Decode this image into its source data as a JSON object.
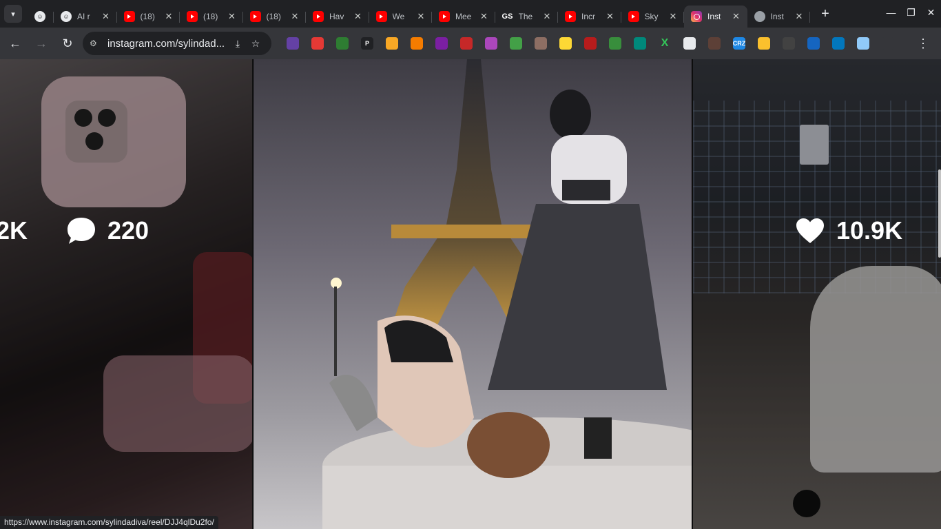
{
  "tabstrip": {
    "search_icon": "chevron-down-icon",
    "tabs": [
      {
        "title": "",
        "favicon": "ai-face"
      },
      {
        "title": "AI r",
        "favicon": "ai-face"
      },
      {
        "title": "(18)",
        "favicon": "youtube"
      },
      {
        "title": "(18)",
        "favicon": "youtube"
      },
      {
        "title": "(18)",
        "favicon": "youtube"
      },
      {
        "title": "Hav",
        "favicon": "youtube"
      },
      {
        "title": "We",
        "favicon": "youtube"
      },
      {
        "title": "Mee",
        "favicon": "youtube"
      },
      {
        "title": "The",
        "favicon": "gs"
      },
      {
        "title": "Incr",
        "favicon": "youtube"
      },
      {
        "title": "Sky",
        "favicon": "youtube"
      },
      {
        "title": "Inst",
        "favicon": "instagram",
        "active": true
      },
      {
        "title": "Inst",
        "favicon": "generic"
      }
    ],
    "new_tab": "+",
    "gs_label": "GS"
  },
  "toolbar": {
    "url": "instagram.com/sylindad...",
    "back_icon": "back-arrow-icon",
    "forward_icon": "forward-arrow-icon",
    "reload_icon": "reload-icon",
    "extensions": [
      {
        "name": "twitch-ext",
        "color": "#6441a5"
      },
      {
        "name": "red-shield-ext",
        "color": "#e53935"
      },
      {
        "name": "green-shield-ext",
        "color": "#2e7d32"
      },
      {
        "name": "p-ext",
        "color": "#202124",
        "label": "P"
      },
      {
        "name": "medal-ext",
        "color": "#f9a825"
      },
      {
        "name": "orange-ext",
        "color": "#f57c00"
      },
      {
        "name": "purple-circle-ext",
        "color": "#7b1fa2"
      },
      {
        "name": "game-ext",
        "color": "#c62828"
      },
      {
        "name": "brain-ext",
        "color": "#ab47bc"
      },
      {
        "name": "green-block-ext",
        "color": "#43a047"
      },
      {
        "name": "avatar-ext",
        "color": "#8d6e63"
      },
      {
        "name": "pacman-ext",
        "color": "#fdd835"
      },
      {
        "name": "skull-ext",
        "color": "#b71c1c"
      },
      {
        "name": "green-robot-ext",
        "color": "#388e3c"
      },
      {
        "name": "ghost-ext",
        "color": "#00897b"
      },
      {
        "name": "x-ext",
        "color": "#2e7d32",
        "label": "X"
      },
      {
        "name": "car-ext",
        "color": "#e8eaed"
      },
      {
        "name": "mask-ext",
        "color": "#5d4037"
      },
      {
        "name": "crz-ext",
        "color": "#1e88e5",
        "label": "CRZ"
      },
      {
        "name": "drive-ext",
        "color": "#fbc02d"
      },
      {
        "name": "dots-ext",
        "color": "#424242"
      },
      {
        "name": "lock-ext",
        "color": "#1565c0"
      },
      {
        "name": "blue-square-ext",
        "color": "#0277bd"
      },
      {
        "name": "tile-ext",
        "color": "#90caf9"
      },
      {
        "name": "puzzle-ext",
        "color": "#35363a"
      }
    ]
  },
  "reels": {
    "left": {
      "comments": "220",
      "likes_partial": "2K"
    },
    "right": {
      "likes": "10.9K"
    }
  },
  "statusbar": {
    "url": "https://www.instagram.com/sylindadiva/reel/DJJ4qlDu2fo/"
  }
}
